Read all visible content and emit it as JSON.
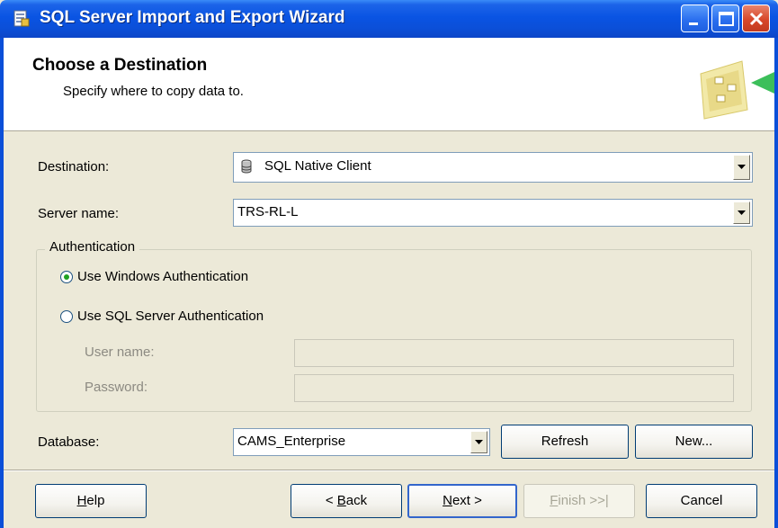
{
  "window": {
    "title": "SQL Server Import and Export Wizard"
  },
  "header": {
    "title": "Choose a Destination",
    "subtitle": "Specify where to copy data to."
  },
  "form": {
    "destination": {
      "label": "Destination:",
      "value": "SQL Native Client"
    },
    "server_name": {
      "label": "Server name:",
      "value": "TRS-RL-L"
    },
    "authentication": {
      "legend": "Authentication",
      "windows_auth": {
        "label": "Use Windows Authentication",
        "selected": true
      },
      "sql_auth": {
        "label": "Use SQL Server Authentication",
        "selected": false
      },
      "user_name": {
        "label": "User name:",
        "value": ""
      },
      "password": {
        "label": "Password:",
        "value": ""
      }
    },
    "database": {
      "label": "Database:",
      "value": "CAMS_Enterprise"
    },
    "refresh_label": "Refresh",
    "new_label": "New..."
  },
  "footer": {
    "help": {
      "pre": "",
      "key": "H",
      "post": "elp"
    },
    "back": {
      "pre": "< ",
      "key": "B",
      "post": "ack"
    },
    "next": {
      "pre": "",
      "key": "N",
      "post": "ext >"
    },
    "finish": {
      "pre": "",
      "key": "F",
      "post": "inish >>|"
    },
    "cancel": "Cancel"
  },
  "colors": {
    "titlebar": "#0b4fd8",
    "dialog_bg": "#ece9d8",
    "radio_selected": "#21a121"
  }
}
